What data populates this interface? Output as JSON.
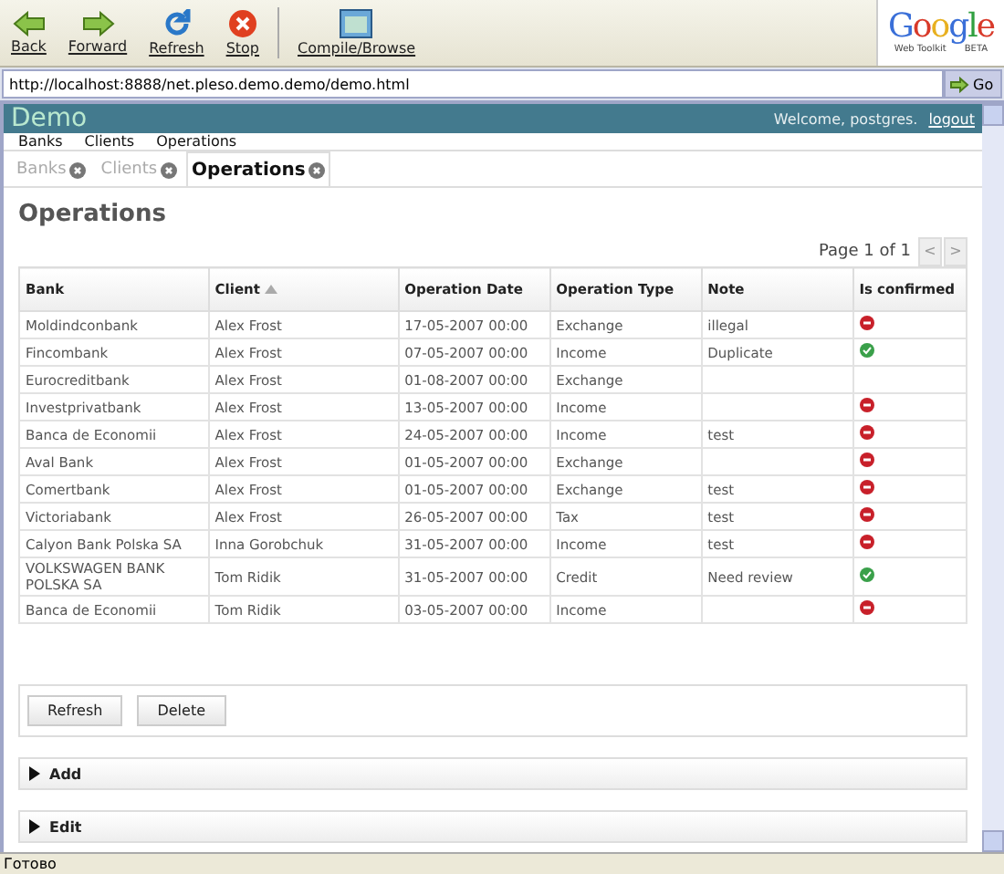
{
  "toolbar": {
    "buttons": [
      {
        "kind": "back",
        "label": "Back"
      },
      {
        "kind": "forward",
        "label": "Forward"
      },
      {
        "kind": "refresh",
        "label": "Refresh"
      },
      {
        "kind": "stop",
        "label": "Stop"
      },
      {
        "kind": "compile",
        "label": "Compile/Browse"
      }
    ],
    "logo": {
      "name": "Google",
      "tagline": "Web Toolkit",
      "badge": "BETA"
    }
  },
  "address_bar": {
    "url": "http://localhost:8888/net.pleso.demo.demo/demo.html",
    "go_label": "Go"
  },
  "header": {
    "title": "Demo",
    "welcome": "Welcome, postgres.",
    "logout": "logout"
  },
  "menu": [
    "Banks",
    "Clients",
    "Operations"
  ],
  "tabs": [
    {
      "label": "Banks",
      "selected": false
    },
    {
      "label": "Clients",
      "selected": false
    },
    {
      "label": "Operations",
      "selected": true
    }
  ],
  "page_title": "Operations",
  "pager": {
    "text": "Page 1 of 1",
    "prev": "<",
    "next": ">"
  },
  "table": {
    "columns": [
      {
        "label": "Bank",
        "sorted": false
      },
      {
        "label": "Client",
        "sorted": true
      },
      {
        "label": "Operation Date",
        "sorted": false
      },
      {
        "label": "Operation Type",
        "sorted": false
      },
      {
        "label": "Note",
        "sorted": false
      },
      {
        "label": "Is confirmed",
        "sorted": false
      }
    ],
    "rows": [
      {
        "bank": "Moldindconbank",
        "client": "Alex Frost",
        "date": "17-05-2007 00:00",
        "type": "Exchange",
        "note": "illegal",
        "confirmed": false
      },
      {
        "bank": "Fincombank",
        "client": "Alex Frost",
        "date": "07-05-2007 00:00",
        "type": "Income",
        "note": "Duplicate",
        "confirmed": true
      },
      {
        "bank": "Eurocreditbank",
        "client": "Alex Frost",
        "date": "01-08-2007 00:00",
        "type": "Exchange"
      },
      {
        "bank": "Investprivatbank",
        "client": "Alex Frost",
        "date": "13-05-2007 00:00",
        "type": "Income",
        "confirmed": false
      },
      {
        "bank": "Banca de Economii",
        "client": "Alex Frost",
        "date": "24-05-2007 00:00",
        "type": "Income",
        "note": "test",
        "confirmed": false
      },
      {
        "bank": "Aval Bank",
        "client": "Alex Frost",
        "date": "01-05-2007 00:00",
        "type": "Exchange",
        "confirmed": false
      },
      {
        "bank": "Comertbank",
        "client": "Alex Frost",
        "date": "01-05-2007 00:00",
        "type": "Exchange",
        "note": "test",
        "confirmed": false
      },
      {
        "bank": "Victoriabank",
        "client": "Alex Frost",
        "date": "26-05-2007 00:00",
        "type": "Tax",
        "note": "test",
        "confirmed": false
      },
      {
        "bank": "Calyon Bank Polska SA",
        "client": "Inna Gorobchuk",
        "date": "31-05-2007 00:00",
        "type": "Income",
        "note": "test",
        "confirmed": false
      },
      {
        "bank": "VOLKSWAGEN BANK POLSKA SA",
        "client": "Tom Ridik",
        "date": "31-05-2007 00:00",
        "type": "Credit",
        "note": "Need review",
        "confirmed": true
      },
      {
        "bank": "Banca de Economii",
        "client": "Tom Ridik",
        "date": "03-05-2007 00:00",
        "type": "Income",
        "confirmed": false
      }
    ]
  },
  "actions": [
    "Refresh",
    "Delete"
  ],
  "sections": [
    {
      "label": "Add",
      "expanded": false
    },
    {
      "label": "Edit",
      "expanded": false
    }
  ],
  "status_bar": "Готово"
}
